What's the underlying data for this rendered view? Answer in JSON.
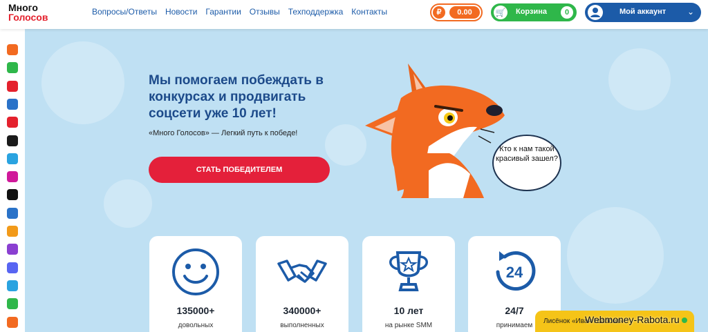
{
  "header": {
    "logo_line1": "Много",
    "logo_line2": "Голосов",
    "nav": [
      "Вопросы/Ответы",
      "Новости",
      "Гарантии",
      "Отзывы",
      "Техподдержка",
      "Контакты"
    ],
    "balance_currency": "₽",
    "balance_value": "0.00",
    "cart_label": "Корзина",
    "cart_count": "0",
    "account_label": "Мой аккаунт"
  },
  "sidebar": {
    "icons": [
      {
        "name": "trophy-icon",
        "color": "#f26a21"
      },
      {
        "name": "tv-icon",
        "color": "#2fb74a"
      },
      {
        "name": "zen-icon",
        "color": "#e4212d"
      },
      {
        "name": "vk-icon",
        "color": "#2a72c8"
      },
      {
        "name": "youtube-icon",
        "color": "#e4212d"
      },
      {
        "name": "rutube-icon",
        "color": "#1b1b1b"
      },
      {
        "name": "telegram-icon",
        "color": "#2aa3e0"
      },
      {
        "name": "eye-icon",
        "color": "#d0199a"
      },
      {
        "name": "tiktok-icon",
        "color": "#111111"
      },
      {
        "name": "messenger-icon",
        "color": "#2a72c8"
      },
      {
        "name": "odnoklassniki-icon",
        "color": "#f29a1a"
      },
      {
        "name": "twitch-icon",
        "color": "#8a3fd1"
      },
      {
        "name": "discord-icon",
        "color": "#5865f2"
      },
      {
        "name": "twitter-icon",
        "color": "#2aa3e0"
      },
      {
        "name": "spotify-icon",
        "color": "#2fb74a"
      },
      {
        "name": "soundcloud-icon",
        "color": "#f26a21"
      }
    ]
  },
  "hero": {
    "title": "Мы помогаем побеждать в конкурсах и продвигать соцсети уже 10 лет!",
    "subtitle": "«Много Голосов» — Легкий путь к победе!",
    "cta_label": "СТАТЬ ПОБЕДИТЕЛЕМ",
    "speech": "Кто к нам такой красивый зашел?"
  },
  "stats": [
    {
      "icon": "smile-icon",
      "number": "135000+",
      "desc": "довольных"
    },
    {
      "icon": "handshake-icon",
      "number": "340000+",
      "desc": "выполненных"
    },
    {
      "icon": "trophy-icon",
      "number": "10 лет",
      "desc": "на рынке SMM"
    },
    {
      "icon": "clock-24-icon",
      "number": "24/7",
      "desc": "принимаем"
    }
  ],
  "chat": {
    "label": "Лисёнок «Иван Голосов»"
  },
  "watermark": "Webmoney-Rabota.ru",
  "colors": {
    "brand_blue": "#1c5ba8",
    "brand_red": "#e4203a",
    "orange": "#f26a21",
    "green": "#2fb74a"
  }
}
